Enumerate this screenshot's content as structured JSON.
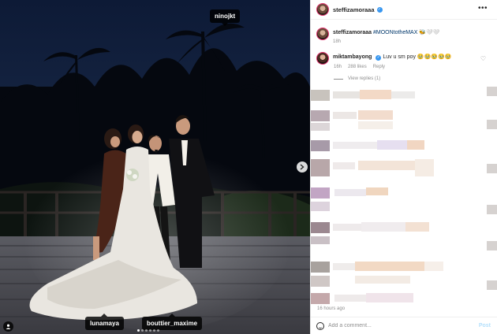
{
  "photo": {
    "tags": {
      "top": "ninojkt",
      "bottom_left": "lunamaya",
      "bottom_right": "bouttier_maxime"
    },
    "carousel": {
      "total": 6,
      "active": 1
    },
    "icons": {
      "next": "chevron-right-icon",
      "tagged": "user-icon"
    }
  },
  "post": {
    "author": "steffizamoraaa",
    "verified": true,
    "caption": {
      "username": "steffizamoraaa",
      "hashtag": "#MOONtotheMAX",
      "emojis": "🐝🤍🤍",
      "time": "18h"
    },
    "comment": {
      "username": "miktambayong",
      "text": "Luv u sm poy",
      "emojis": "🥹🥹🥹🥹🥹",
      "time": "16h",
      "likes": "288 likes",
      "reply": "Reply"
    },
    "view_replies": "View replies (1)",
    "posted": "16 hours ago"
  },
  "comment_box": {
    "placeholder": "Add a comment...",
    "post_label": "Post"
  },
  "colors": {
    "accent": "#3897f0",
    "hashtag": "#00376b",
    "post_disabled": "#b2dffc",
    "muted": "#8e8e8e"
  }
}
